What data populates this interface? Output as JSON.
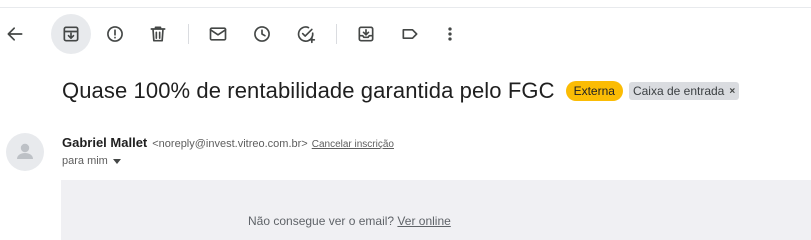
{
  "toolbar": {
    "buttons": [
      {
        "name": "back-button",
        "icon": "arrow-left-icon"
      },
      {
        "name": "archive-button",
        "icon": "archive-icon"
      },
      {
        "name": "report-spam-button",
        "icon": "report-icon"
      },
      {
        "name": "delete-button",
        "icon": "trash-icon"
      },
      {
        "name": "mark-unread-button",
        "icon": "mail-icon"
      },
      {
        "name": "snooze-button",
        "icon": "clock-icon"
      },
      {
        "name": "add-task-button",
        "icon": "add-task-icon"
      },
      {
        "name": "move-to-button",
        "icon": "move-to-inbox-icon"
      },
      {
        "name": "labels-button",
        "icon": "label-icon"
      },
      {
        "name": "more-button",
        "icon": "more-vert-icon"
      }
    ]
  },
  "email": {
    "subject": "Quase 100% de rentabilidade garantida pelo FGC",
    "external_badge": "Externa",
    "label": "Caixa de entrada",
    "label_remove": "×",
    "sender_name": "Gabriel Mallet",
    "sender_email": "<noreply@invest.vitreo.com.br>",
    "unsubscribe": "Cancelar inscrição",
    "to": "para mim",
    "preheader_text": "Não consegue ver o email? ",
    "preheader_link": "Ver online"
  },
  "colors": {
    "external_badge": "#fbbc04",
    "label_chip": "#dadce0",
    "body_bg": "#f0f0f3",
    "active_button_bg": "#e8eaed"
  }
}
